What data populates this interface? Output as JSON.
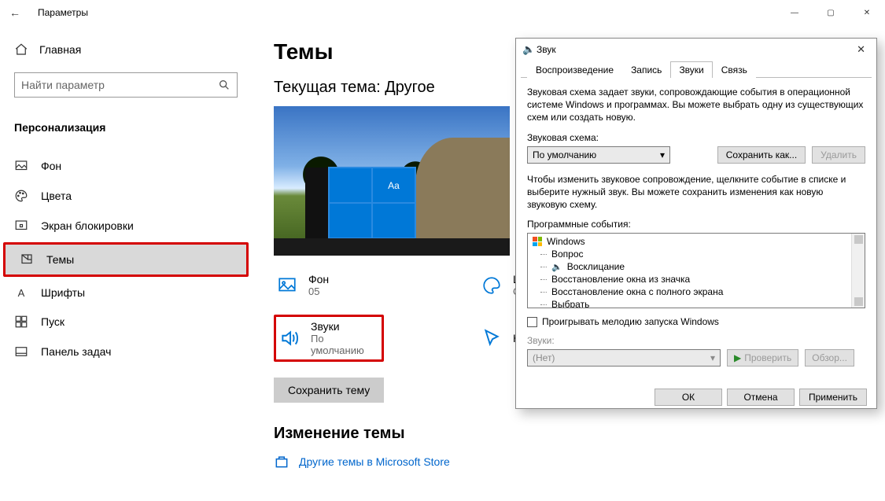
{
  "window": {
    "title": "Параметры",
    "back_glyph": "←",
    "min_glyph": "―",
    "max_glyph": "▢",
    "close_glyph": "✕"
  },
  "sidebar": {
    "home": "Главная",
    "search_placeholder": "Найти параметр",
    "category": "Персонализация",
    "items": [
      {
        "label": "Фон"
      },
      {
        "label": "Цвета"
      },
      {
        "label": "Экран блокировки"
      },
      {
        "label": "Темы"
      },
      {
        "label": "Шрифты"
      },
      {
        "label": "Пуск"
      },
      {
        "label": "Панель задач"
      }
    ]
  },
  "main": {
    "heading": "Темы",
    "current_theme_label": "Текущая тема: Другое",
    "aa_sample": "Aa",
    "tiles": {
      "bg_title": "Фон",
      "bg_value": "05",
      "colors_title": "Ц",
      "colors_value": "С",
      "sounds_title": "Звуки",
      "sounds_value": "По умолчанию",
      "cursor_title": "К",
      "cursor_value": " "
    },
    "save_button": "Сохранить тему",
    "change_heading": "Изменение темы",
    "store_link": "Другие темы в Microsoft Store"
  },
  "sound_dialog": {
    "title": "Звук",
    "close_glyph": "✕",
    "tabs": [
      "Воспроизведение",
      "Запись",
      "Звуки",
      "Связь"
    ],
    "active_tab_index": 2,
    "desc1": "Звуковая схема задает звуки, сопровождающие события в операционной системе Windows и программах. Вы можете выбрать одну из существующих схем или создать новую.",
    "scheme_label": "Звуковая схема:",
    "scheme_value": "По умолчанию",
    "save_as": "Сохранить как...",
    "delete": "Удалить",
    "desc2": "Чтобы изменить звуковое сопровождение, щелкните событие в списке и выберите нужный звук. Вы можете сохранить изменения как новую звуковую схему.",
    "events_label": "Программные события:",
    "tree": {
      "root": "Windows",
      "children": [
        {
          "label": "Вопрос",
          "has_sound": false
        },
        {
          "label": "Восклицание",
          "has_sound": true
        },
        {
          "label": "Восстановление окна из значка",
          "has_sound": false
        },
        {
          "label": "Восстановление окна с полного экрана",
          "has_sound": false
        },
        {
          "label": "Выбрать",
          "has_sound": false
        }
      ]
    },
    "play_startup": "Проигрывать мелодию запуска Windows",
    "sounds_label": "Звуки:",
    "sound_value": "(Нет)",
    "test": "Проверить",
    "browse": "Обзор...",
    "ok": "ОК",
    "cancel": "Отмена",
    "apply": "Применить"
  }
}
